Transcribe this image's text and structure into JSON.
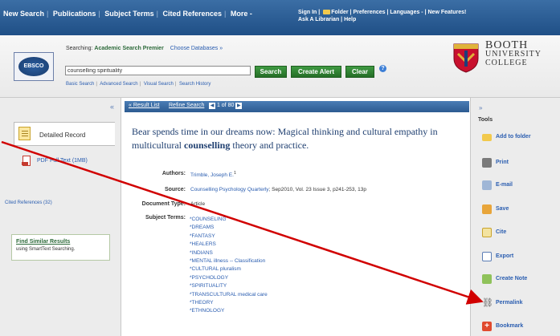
{
  "top_nav": {
    "items": [
      "New Search",
      "Publications",
      "Subject Terms",
      "Cited References",
      "More -"
    ],
    "right_line1": [
      "Sign In",
      "Folder",
      "Preferences",
      "Languages -",
      "New Features!"
    ],
    "right_line2": [
      "Ask A Librarian",
      "Help"
    ]
  },
  "search": {
    "searching_prefix": "Searching:",
    "database": "Academic Search Premier",
    "choose_databases": "Choose Databases »",
    "query": "counselling spirituality",
    "search_button": "Search",
    "create_alert_button": "Create Alert",
    "clear_button": "Clear",
    "sublinks": [
      "Basic Search",
      "Advanced Search",
      "Visual Search",
      "Search History"
    ],
    "logo_text": "EBSCO"
  },
  "branding": {
    "line1": "Booth",
    "line2": "University",
    "line3": "College"
  },
  "left": {
    "detailed_record": "Detailed Record",
    "pdf_full_text": "PDF Full Text (1MB)",
    "cited_references": "Cited References (32)",
    "find_similar_title": "Find Similar Results",
    "find_similar_sub": "using SmartText Searching."
  },
  "result_bar": {
    "result_list": "« Result List",
    "refine_search": "Refine Search",
    "pager": "1 of 80"
  },
  "record": {
    "title_part1": "Bear spends time in our dreams now: Magical thinking and cultural empathy in multicultural ",
    "title_bold": "counselling",
    "title_part2": " theory and practice.",
    "authors_label": "Authors:",
    "authors_value": "Trimble, Joseph E.",
    "source_label": "Source:",
    "source_journal": "Counselling Psychology Quarterly",
    "source_rest": "; Sep2010, Vol. 23 Issue 3, p241-253, 13p",
    "doctype_label": "Document Type:",
    "doctype_value": "Article",
    "subject_label": "Subject Terms:",
    "subject_terms": [
      "*COUNSELING",
      "*DREAMS",
      "*FANTASY",
      "*HEALERS",
      "*INDIANS",
      "*MENTAL illness -- Classification",
      "*CULTURAL pluralism",
      "*PSYCHOLOGY",
      "*SPIRITUALITY",
      "*TRANSCULTURAL medical care",
      "*THEORY",
      "*ETHNOLOGY"
    ]
  },
  "tools": {
    "title": "Tools",
    "items": [
      "Add to folder",
      "Print",
      "E-mail",
      "Save",
      "Cite",
      "Export",
      "Create Note",
      "Permalink",
      "Bookmark"
    ]
  },
  "colors": {
    "topbar": "#2b5c93",
    "green_button": "#2f8733",
    "link": "#2a5db0",
    "title": "#1f3f70",
    "annotation_arrow": "#d10000"
  }
}
